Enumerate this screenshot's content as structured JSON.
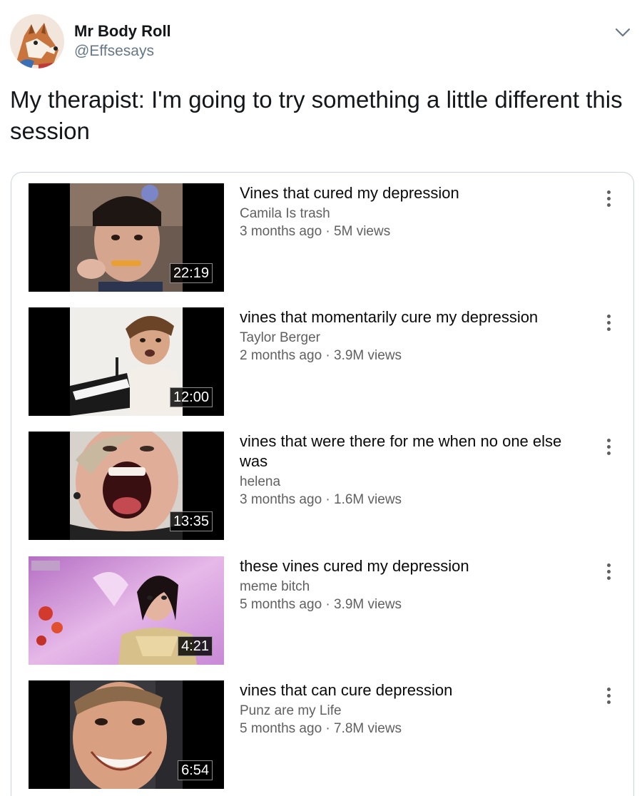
{
  "tweet": {
    "display_name": "Mr Body Roll",
    "handle": "@Effsesays",
    "text": "My therapist: I'm going to try something a little different this session"
  },
  "videos": [
    {
      "title": "Vines that cured my depression",
      "channel": "Camila Is trash",
      "stats": "3 months ago · 5M views",
      "duration": "22:19"
    },
    {
      "title": "vines that momentarily cure my depression",
      "channel": "Taylor Berger",
      "stats": "2 months ago · 3.9M views",
      "duration": "12:00"
    },
    {
      "title": "vines that were there for me when no one else was",
      "channel": "helena",
      "stats": "3 months ago · 1.6M views",
      "duration": "13:35"
    },
    {
      "title": "these vines cured my depression",
      "channel": "meme bitch",
      "stats": "5 months ago · 3.9M views",
      "duration": "4:21"
    },
    {
      "title": "vines that can cure depression",
      "channel": "Punz are my Life",
      "stats": "5 months ago · 7.8M views",
      "duration": "6:54"
    }
  ],
  "icons": {
    "avatar": "fox-avatar-icon",
    "caret": "chevron-down-icon",
    "menu": "more-vertical-icon"
  }
}
